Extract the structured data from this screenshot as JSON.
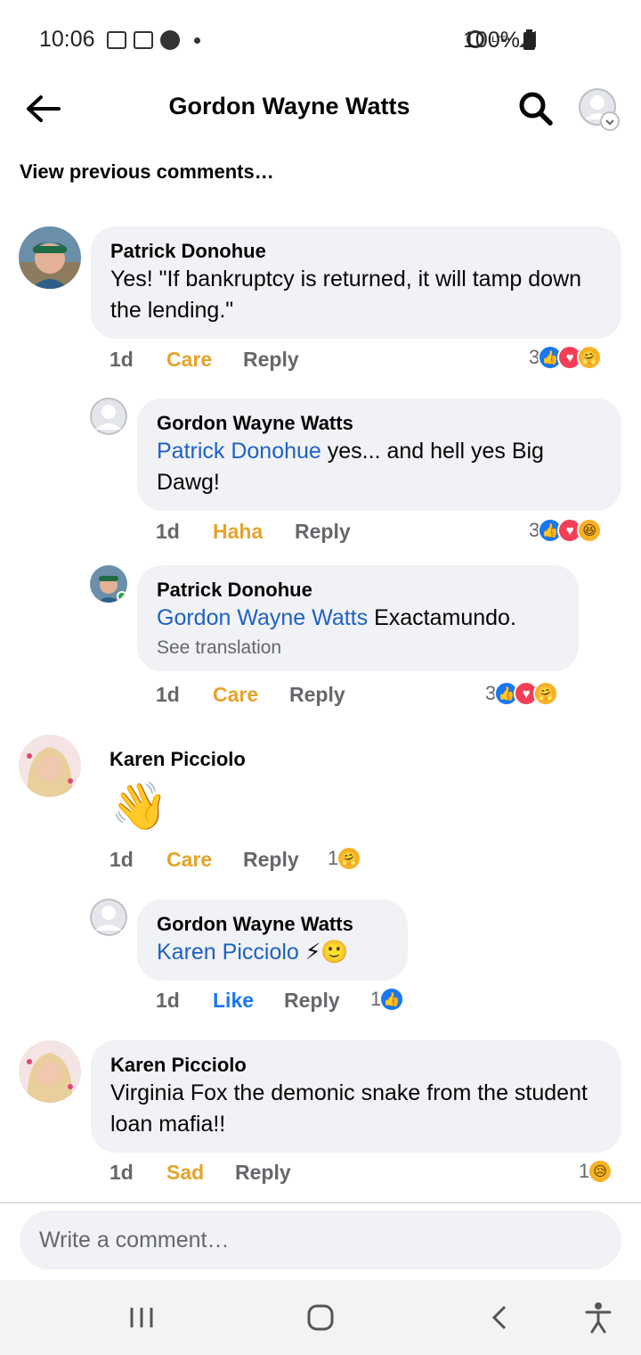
{
  "status_bar": {
    "time": "10:06",
    "network": "LTE+",
    "battery": "100%"
  },
  "header": {
    "title": "Gordon Wayne Watts"
  },
  "view_previous": "View previous comments…",
  "comments": [
    {
      "author": "Patrick Donohue",
      "text": "Yes! \"If bankruptcy is returned, it will tamp down the lending.\"",
      "time": "1d",
      "reaction": "Care",
      "reply": "Reply",
      "reaction_count": "3",
      "reaction_icons": [
        "like-icon",
        "love-icon",
        "care-icon"
      ]
    },
    {
      "author": "Gordon Wayne Watts",
      "mention": "Patrick Donohue",
      "text": " yes... and hell yes Big Dawg!",
      "time": "1d",
      "reaction": "Haha",
      "reply": "Reply",
      "reaction_count": "3",
      "reaction_icons": [
        "like-icon",
        "love-icon",
        "haha-icon"
      ]
    },
    {
      "author": "Patrick Donohue",
      "mention": "Gordon Wayne Watts",
      "text": " Exactamundo.",
      "see_translation": "See translation",
      "time": "1d",
      "reaction": "Care",
      "reply": "Reply",
      "reaction_count": "3",
      "reaction_icons": [
        "like-icon",
        "love-icon",
        "care-icon"
      ]
    },
    {
      "author": "Karen Picciolo",
      "emoji": "👋",
      "time": "1d",
      "reaction": "Care",
      "reply": "Reply",
      "reaction_count": "1",
      "reaction_icons": [
        "care-icon"
      ]
    },
    {
      "author": "Gordon Wayne Watts",
      "mention": "Karen Picciolo",
      "text": " ⚡🙂",
      "time": "1d",
      "reaction": "Like",
      "reply": "Reply",
      "reaction_count": "1",
      "reaction_icons": [
        "like-icon"
      ]
    },
    {
      "author": "Karen Picciolo",
      "text": "Virginia Fox the  demonic snake from the student loan mafia!!",
      "time": "1d",
      "reaction": "Sad",
      "reply": "Reply",
      "reaction_count": "1",
      "reaction_icons": [
        "sad-icon"
      ]
    }
  ],
  "composer": {
    "placeholder": "Write a comment…"
  },
  "colors": {
    "accent": "#1877f2",
    "mention": "#1f61c3",
    "care": "#e5a32b",
    "bubble": "#f0f2f5",
    "secondary_text": "#65676b"
  }
}
